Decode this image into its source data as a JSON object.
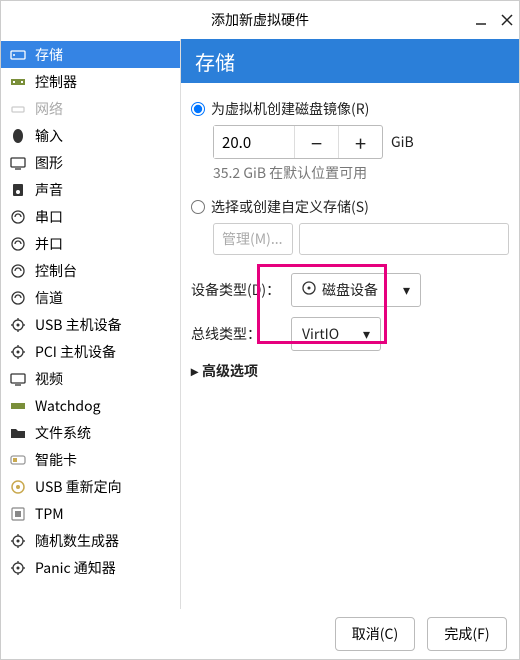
{
  "window": {
    "title": "添加新虚拟硬件"
  },
  "sidebar": {
    "items": [
      {
        "label": "存储",
        "icon": "storage",
        "selected": true
      },
      {
        "label": "控制器",
        "icon": "controller"
      },
      {
        "label": "网络",
        "icon": "network",
        "dim": true
      },
      {
        "label": "输入",
        "icon": "input"
      },
      {
        "label": "图形",
        "icon": "graphics"
      },
      {
        "label": "声音",
        "icon": "sound"
      },
      {
        "label": "串口",
        "icon": "serial"
      },
      {
        "label": "并口",
        "icon": "parallel"
      },
      {
        "label": "控制台",
        "icon": "console"
      },
      {
        "label": "信道",
        "icon": "channel"
      },
      {
        "label": "USB 主机设备",
        "icon": "usb-host"
      },
      {
        "label": "PCI 主机设备",
        "icon": "pci-host"
      },
      {
        "label": "视频",
        "icon": "video"
      },
      {
        "label": "Watchdog",
        "icon": "watchdog"
      },
      {
        "label": "文件系统",
        "icon": "filesystem"
      },
      {
        "label": "智能卡",
        "icon": "smartcard"
      },
      {
        "label": "USB 重新定向",
        "icon": "usb-redir"
      },
      {
        "label": "TPM",
        "icon": "tpm"
      },
      {
        "label": "随机数生成器",
        "icon": "rng"
      },
      {
        "label": "Panic 通知器",
        "icon": "panic"
      }
    ]
  },
  "panel": {
    "title": "存储",
    "create_image_label": "为虚拟机创建磁盘镜像(R)",
    "size_value": "20.0",
    "size_unit": "GiB",
    "available_hint": "35.2 GiB 在默认位置可用",
    "custom_storage_label": "选择或创建自定义存储(S)",
    "manage_placeholder": "管理(M)...",
    "device_type_label": "设备类型(D)：",
    "device_type_value": "磁盘设备",
    "bus_type_label": "总线类型：",
    "bus_type_value": "VirtIO",
    "advanced_label": "高级选项",
    "radio_selected": "create"
  },
  "footer": {
    "cancel": "取消(C)",
    "finish": "完成(F)"
  }
}
